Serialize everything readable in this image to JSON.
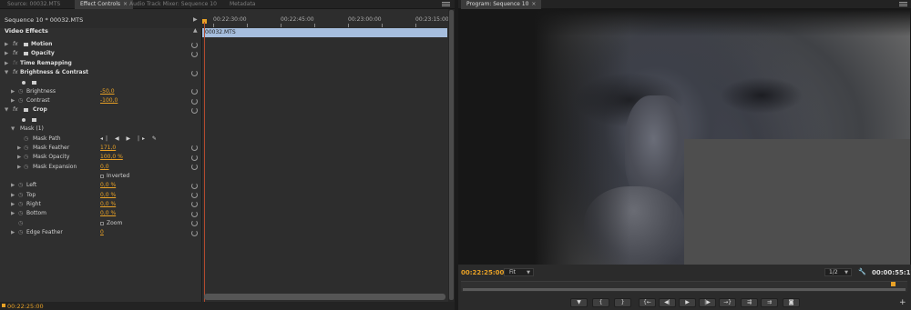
{
  "left_tabs": [
    {
      "label": "Source: 00032.MTS",
      "active": false
    },
    {
      "label": "Effect Controls",
      "active": true,
      "closable": true
    },
    {
      "label": "Audio Track Mixer: Sequence 10",
      "active": false
    },
    {
      "label": "Metadata",
      "active": false
    }
  ],
  "right_tabs": [
    {
      "label": "Program: Sequence 10",
      "active": true,
      "closable": true
    }
  ],
  "effect_controls": {
    "sequence_label": "Sequence 10 * 00032.MTS",
    "section_label": "Video Effects",
    "rows": [
      {
        "type": "effect",
        "name": "Motion"
      },
      {
        "type": "effect",
        "name": "Opacity"
      },
      {
        "type": "effect_nofx",
        "name": "Time Remapping"
      },
      {
        "type": "effect_open",
        "name": "Brightness & Contrast"
      },
      {
        "type": "shapes"
      },
      {
        "type": "param",
        "name": "Brightness",
        "value": "-50,0"
      },
      {
        "type": "param",
        "name": "Contrast",
        "value": "-100,0"
      },
      {
        "type": "effect_open",
        "name": "Crop"
      },
      {
        "type": "shapes"
      },
      {
        "type": "mask",
        "name": "Mask (1)"
      },
      {
        "type": "maskpath",
        "name": "Mask Path",
        "buttons": "◂| ◀ ▶ |▸ ✎"
      },
      {
        "type": "subparam",
        "name": "Mask Feather",
        "value": "171,0"
      },
      {
        "type": "subparam",
        "name": "Mask Opacity",
        "value": "100,0 %"
      },
      {
        "type": "subparam",
        "name": "Mask Expansion",
        "value": "0,0"
      },
      {
        "type": "check",
        "name": "Inverted"
      },
      {
        "type": "param",
        "name": "Left",
        "value": "0,0 %"
      },
      {
        "type": "param",
        "name": "Top",
        "value": "0,0 %"
      },
      {
        "type": "param",
        "name": "Right",
        "value": "0,0 %"
      },
      {
        "type": "param",
        "name": "Bottom",
        "value": "0,0 %"
      },
      {
        "type": "check_stop",
        "name": "Zoom"
      },
      {
        "type": "param",
        "name": "Edge Feather",
        "value": "0"
      }
    ],
    "timecode": "00:22:25:00"
  },
  "ec_timeline": {
    "ruler_labels": [
      "00:22:30:00",
      "00:22:45:00",
      "00:23:00:00",
      "00:23:15:00"
    ],
    "clip_name": "00032.MTS"
  },
  "program_monitor": {
    "current_timecode": "00:22:25:00",
    "fit_value": "Fit",
    "resolution": "1/2",
    "duration_timecode": "00:00:55:17",
    "transport_buttons": [
      "marker",
      "in-point",
      "out-point",
      "go-to-in",
      "step-back",
      "play",
      "step-forward",
      "go-to-out",
      "insert",
      "overwrite",
      "export-frame"
    ]
  },
  "colors": {
    "accent": "#e8a126",
    "clip": "#a6bede",
    "playhead": "#b24a2e"
  }
}
